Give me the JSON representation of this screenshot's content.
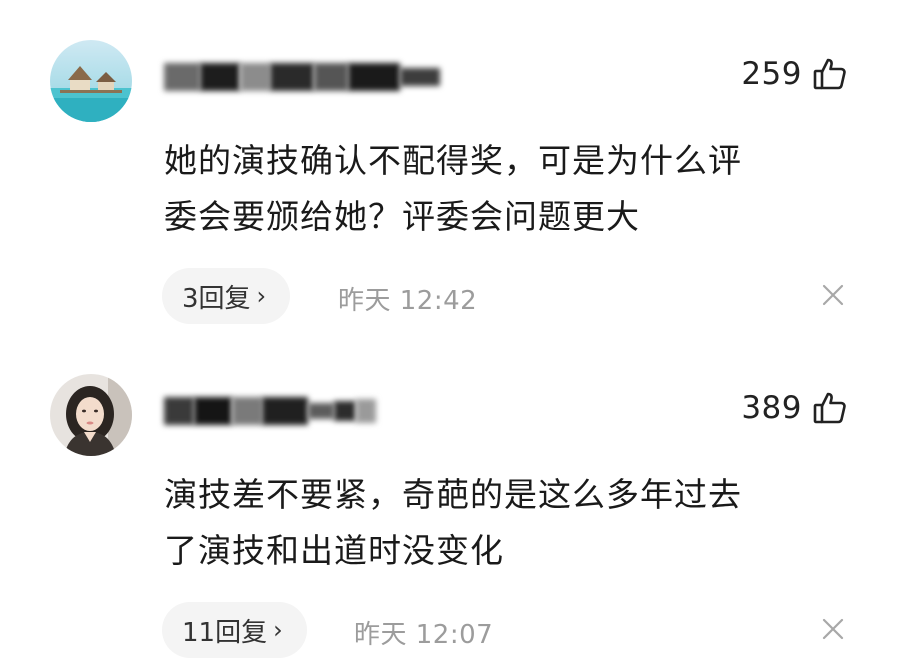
{
  "comments": [
    {
      "likes": "259",
      "text_line1": "她的演技确认不配得奖，可是为什么评",
      "text_line2": "委会要颁给她？评委会问题更大",
      "replies": "3回复",
      "time": "昨天 12:42"
    },
    {
      "likes": "389",
      "text_line1": "演技差不要紧，奇葩的是这么多年过去",
      "text_line2": "了演技和出道时没变化",
      "replies": "11回复",
      "time": "昨天 12:07"
    }
  ],
  "icons": {
    "like": "thumbs-up-outline-icon",
    "close": "close-icon",
    "chevron": "chevron-right-icon"
  },
  "chevron_glyph": "›",
  "colors": {
    "text": "#1a1a1a",
    "muted": "#9c9c9c",
    "pill_bg": "#f4f4f4"
  }
}
